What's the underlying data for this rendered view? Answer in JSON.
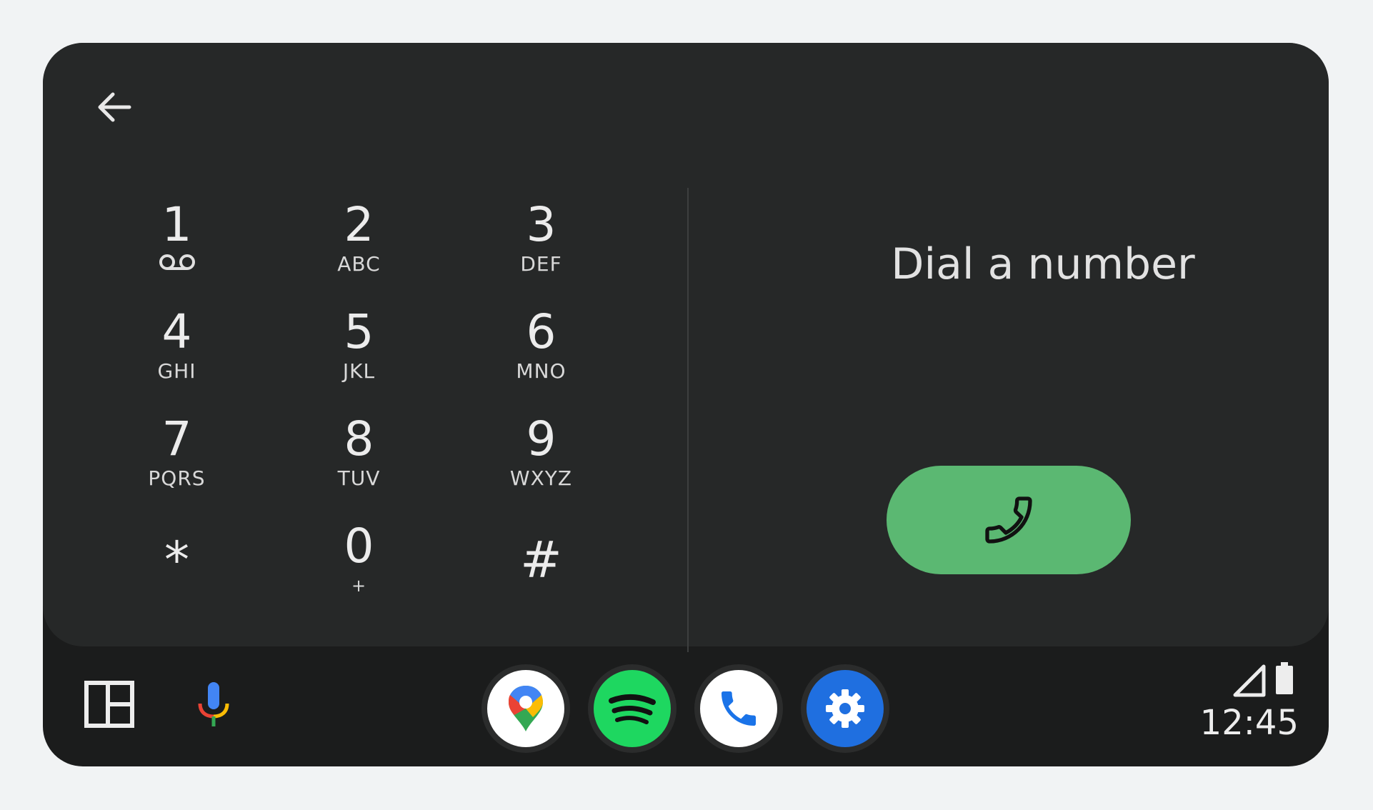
{
  "header": {
    "back_icon": "arrow-back-icon"
  },
  "keypad": {
    "keys": [
      {
        "digit": "1",
        "letters": "",
        "icon": "voicemail-icon"
      },
      {
        "digit": "2",
        "letters": "ABC"
      },
      {
        "digit": "3",
        "letters": "DEF"
      },
      {
        "digit": "4",
        "letters": "GHI"
      },
      {
        "digit": "5",
        "letters": "JKL"
      },
      {
        "digit": "6",
        "letters": "MNO"
      },
      {
        "digit": "7",
        "letters": "PQRS"
      },
      {
        "digit": "8",
        "letters": "TUV"
      },
      {
        "digit": "9",
        "letters": "WXYZ"
      },
      {
        "digit": "*",
        "letters": ""
      },
      {
        "digit": "0",
        "letters": "+"
      },
      {
        "digit": "#",
        "letters": ""
      }
    ]
  },
  "dial": {
    "title": "Dial a number",
    "call_icon": "phone-icon",
    "call_button_color": "#5bb872"
  },
  "taskbar": {
    "layout_icon": "split-layout-icon",
    "mic_icon": "microphone-icon",
    "apps": [
      {
        "name": "maps-app-icon",
        "bg": "#ffffff"
      },
      {
        "name": "spotify-app-icon",
        "bg": "#1ed760"
      },
      {
        "name": "phone-app-icon",
        "bg": "#ffffff"
      },
      {
        "name": "settings-app-icon",
        "bg": "#1f6fe0"
      }
    ],
    "status": {
      "signal_icon": "cell-signal-icon",
      "battery_icon": "battery-icon",
      "time": "12:45"
    }
  },
  "colors": {
    "background": "#f1f3f4",
    "screen": "#262828",
    "taskbar": "#1b1c1c",
    "accent_green": "#5bb872"
  }
}
